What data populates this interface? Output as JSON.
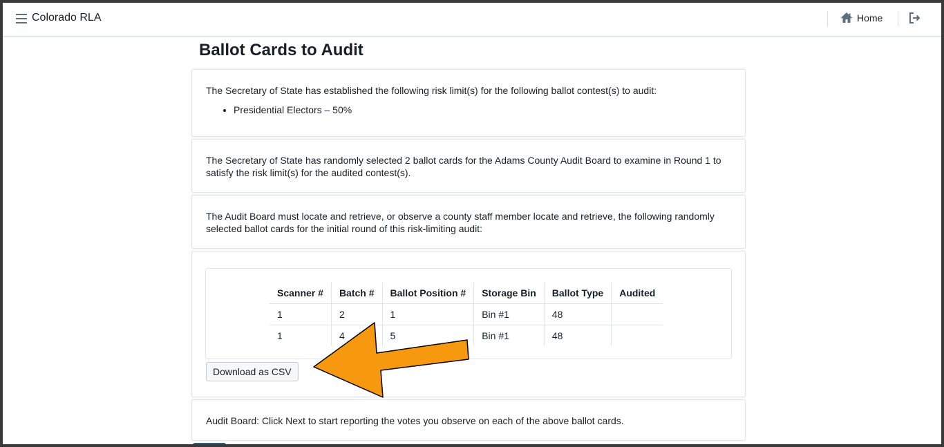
{
  "app": {
    "title": "Colorado RLA"
  },
  "nav": {
    "home_label": "Home"
  },
  "page": {
    "title": "Ballot Cards to Audit"
  },
  "risk_card": {
    "intro": "The Secretary of State has established the following risk limit(s) for the following ballot contest(s) to audit:",
    "contests": [
      "Presidential Electors – 50%"
    ]
  },
  "selection_card": {
    "text": "The Secretary of State has randomly selected 2 ballot cards for the Adams County Audit Board to examine in Round 1 to satisfy the risk limit(s) for the audited contest(s)."
  },
  "retrieve_card": {
    "text": "The Audit Board must locate and retrieve, or observe a county staff member locate and retrieve, the following randomly selected ballot cards for the initial round of this risk-limiting audit:"
  },
  "ballot_table": {
    "headers": [
      "Scanner #",
      "Batch #",
      "Ballot Position #",
      "Storage Bin",
      "Ballot Type",
      "Audited"
    ],
    "rows": [
      [
        "1",
        "2",
        "1",
        "Bin #1",
        "48",
        ""
      ],
      [
        "1",
        "4",
        "5",
        "Bin #1",
        "48",
        ""
      ]
    ]
  },
  "download_button": "Download as CSV",
  "next_card": {
    "text": "Audit Board: Click Next to start reporting the votes you observe on each of the above ballot cards."
  },
  "colors": {
    "arrow_fill": "#f7990f",
    "next_button": "#2b5d80"
  },
  "icons": [
    "menu-icon",
    "home-icon",
    "logout-icon"
  ]
}
